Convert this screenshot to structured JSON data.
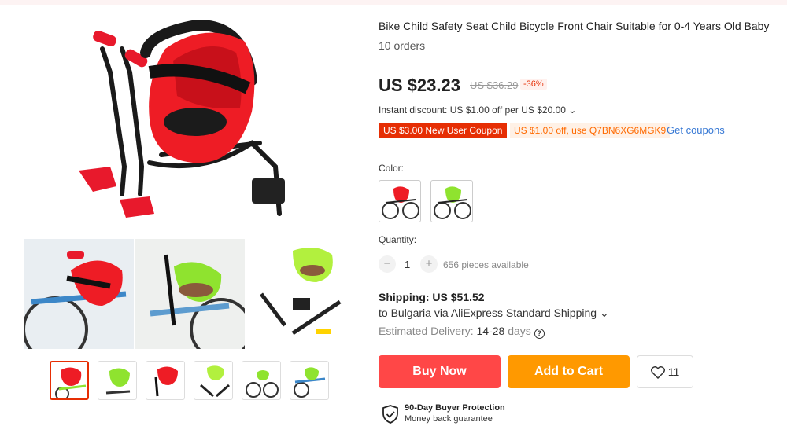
{
  "product": {
    "title": "Bike Child Safety Seat Child Bicycle Front Chair Suitable for 0-4 Years Old Baby",
    "orders": "10 orders"
  },
  "pricing": {
    "price": "US $23.23",
    "original_price": "US $36.29",
    "discount_percent": "-36%",
    "instant_discount": "Instant discount: US $1.00 off per US $20.00",
    "coupon_new_user": "US $3.00 New User Coupon",
    "coupon_code": "US $1.00 off, use Q7BN6XG6MGK9",
    "get_coupons": "Get coupons"
  },
  "color": {
    "label": "Color:",
    "options": [
      "red",
      "green"
    ]
  },
  "quantity": {
    "label": "Quantity:",
    "value": "1",
    "minus": "−",
    "plus": "+",
    "available": "656 pieces available"
  },
  "shipping": {
    "cost": "Shipping: US $51.52",
    "via": "to Bulgaria via AliExpress Standard Shipping ⌄",
    "eta_label": "Estimated Delivery:",
    "eta_days": "14-28",
    "eta_unit": "days"
  },
  "actions": {
    "buy_now": "Buy Now",
    "add_to_cart": "Add to Cart",
    "wishlist_count": "11"
  },
  "protection": {
    "title": "90-Day Buyer Protection",
    "subtitle": "Money back guarantee"
  },
  "gallery": {
    "thumbnails": [
      "red seat on bike",
      "green seat",
      "red seat",
      "green seat parts",
      "red seat mounted",
      "green seat mounted"
    ],
    "active_thumbnail": 0
  },
  "colors": {
    "accent_red": "#e62e04",
    "buy_now": "#ff4747",
    "add_to_cart": "#ff9900",
    "link_blue": "#3577d4",
    "seat_red": "#ee1c25",
    "seat_green": "#8fe32f"
  }
}
